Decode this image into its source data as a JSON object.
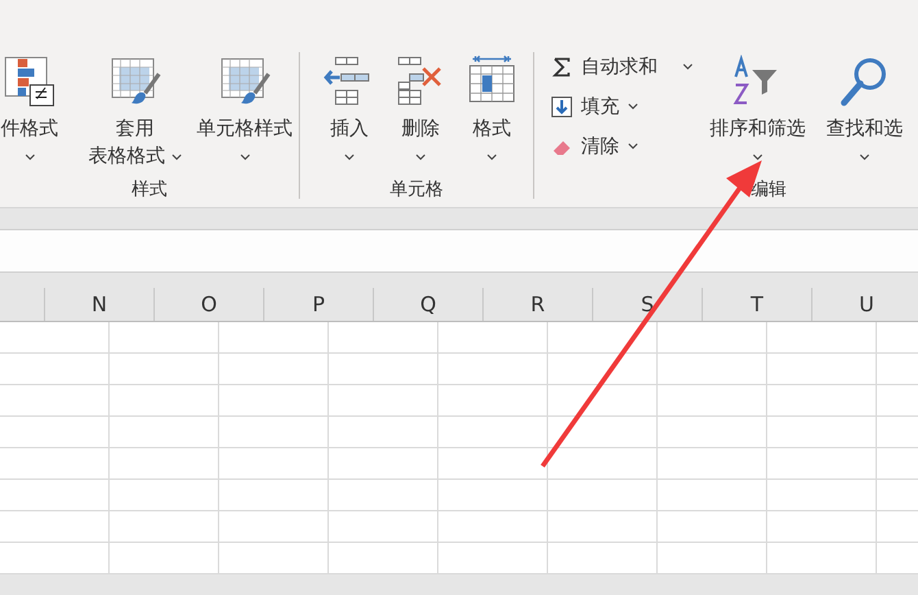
{
  "ribbon": {
    "groups": [
      {
        "label": "样式",
        "buttons": [
          {
            "kind": "large",
            "lines": [
              "件格式"
            ],
            "dropdown": true
          },
          {
            "kind": "large",
            "lines": [
              "套用",
              "表格格式"
            ],
            "dropdown": true
          },
          {
            "kind": "large",
            "lines": [
              "单元格样式"
            ],
            "dropdown": true
          }
        ]
      },
      {
        "label": "单元格",
        "buttons": [
          {
            "kind": "large",
            "lines": [
              "插入"
            ],
            "dropdown": true
          },
          {
            "kind": "large",
            "lines": [
              "删除"
            ],
            "dropdown": true
          },
          {
            "kind": "large",
            "lines": [
              "格式"
            ],
            "dropdown": true
          }
        ]
      },
      {
        "label": "编辑",
        "buttons": [
          {
            "kind": "small",
            "lines": [
              "自动求和"
            ],
            "dropdown": true
          },
          {
            "kind": "small",
            "lines": [
              "填充"
            ],
            "dropdown": true
          },
          {
            "kind": "small",
            "lines": [
              "清除"
            ],
            "dropdown": true
          },
          {
            "kind": "large",
            "lines": [
              "排序和筛选"
            ],
            "dropdown": true
          },
          {
            "kind": "large",
            "lines": [
              "查找和选"
            ],
            "dropdown": true
          }
        ]
      }
    ]
  },
  "sheet": {
    "columns": [
      "N",
      "O",
      "P",
      "Q",
      "R",
      "S",
      "T",
      "U"
    ]
  }
}
